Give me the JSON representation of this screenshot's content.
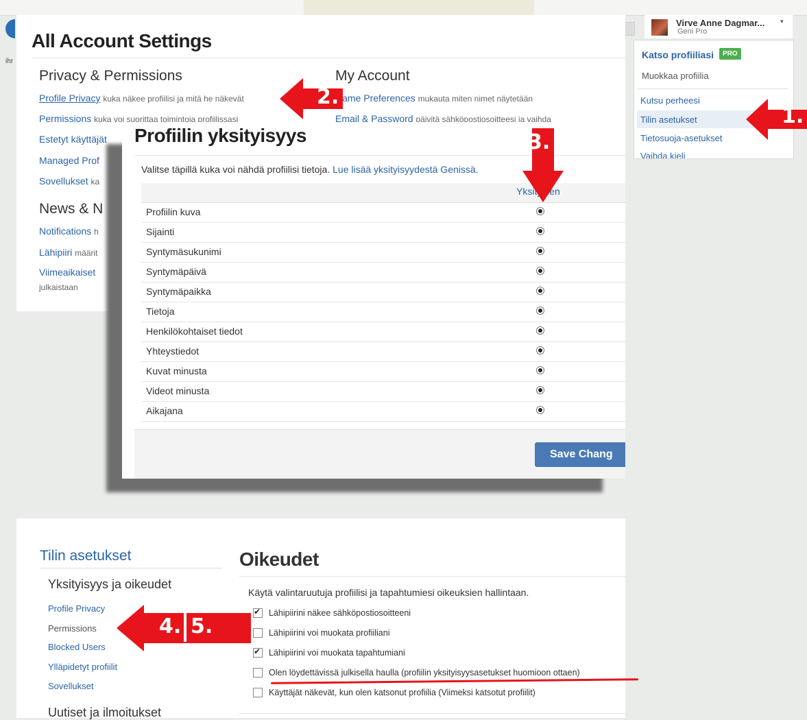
{
  "colors": {
    "link": "#2a64a8",
    "arrow": "#e8141b",
    "pro_badge": "#4caf50",
    "save_button": "#4a7ab5"
  },
  "account_settings": {
    "title": "All Account Settings",
    "privacy_heading": "Privacy & Permissions",
    "privacy_links": [
      {
        "label": "Profile Privacy",
        "desc": "kuka näkee profiilisi ja mitä he näkevät"
      },
      {
        "label": "Permissions",
        "desc": "kuka voi suorittaa toimintoja profiilissasi"
      },
      {
        "label": "Estetyt käyttäjät",
        "desc": ""
      },
      {
        "label": "Managed Prof",
        "desc": ""
      },
      {
        "label": "Sovellukset",
        "desc": "ka"
      }
    ],
    "news_heading": "News & N",
    "news_links": [
      {
        "label": "Notifications",
        "desc": "h"
      },
      {
        "label": "Lähipiiri",
        "desc": "määrit"
      },
      {
        "label": "Viimeaikaiset",
        "desc": ""
      }
    ],
    "news_extra": "julkaistaan",
    "my_account_heading": "My Account",
    "my_account_links": [
      {
        "label": "Name Preferences",
        "desc": "mukauta miten nimet näytetään"
      },
      {
        "label": "Email & Password",
        "desc": "päivitä sähköpostiosoitteesi ja vaihda"
      }
    ]
  },
  "user_menu": {
    "name": "Virve Anne Dagmar...",
    "plan": "Geni Pro",
    "view_profile": "Katso profiiliasi",
    "pro_badge": "PRO",
    "edit_profile": "Muokkaa profiilia",
    "items": [
      "Kutsu perheesi",
      "Tilin asetukset",
      "Tietosuoja-asetukset",
      "Vaihda kieli"
    ]
  },
  "profile_privacy": {
    "title": "Profiilin yksityisyys",
    "intro": "Valitse täpillä kuka voi nähdä profiilisi tietoja.",
    "intro_link": "Lue lisää yksityisyydestä Genissä.",
    "column_header": "Yksityinen",
    "rows": [
      "Profiilin kuva",
      "Sijainti",
      "Syntymäsukunimi",
      "Syntymäpäivä",
      "Syntymäpaikka",
      "Tietoja",
      "Henkilökohtaiset tiedot",
      "Yhteystiedot",
      "Kuvat minusta",
      "Videot minusta",
      "Aikajana"
    ],
    "save_button": "Save Chang"
  },
  "permissions_page": {
    "sidebar_title": "Tilin asetukset",
    "sidebar_section": "Yksityisyys ja oikeudet",
    "sidebar_links": [
      "Profile Privacy",
      "Permissions",
      "Blocked Users",
      "Ylläpidetyt profiilit",
      "Sovellukset"
    ],
    "sidebar_section2": "Uutiset ja ilmoitukset",
    "title": "Oikeudet",
    "intro": "Käytä valintaruutuja profiilisi ja tapahtumiesi oikeuksien hallintaan.",
    "options": [
      {
        "label": "Lähipiirini näkee sähköpostiosoitteeni",
        "checked": true
      },
      {
        "label": "Lähipiirini voi muokata profiiliani",
        "checked": false
      },
      {
        "label": "Lähipiirini voi muokata tapahtumiani",
        "checked": true
      },
      {
        "label": "Olen löydettävissä julkisella haulla (profiilin yksityisyysasetukset huomioon ottaen)",
        "checked": false
      },
      {
        "label": "Käyttäjät näkevät, kun olen katsonut profiilia (Viimeksi katsotut profiilit)",
        "checked": false
      }
    ]
  },
  "annotations": {
    "a1": "1.",
    "a2": "2.",
    "a3": "3.",
    "a4": "4.",
    "a5": "5."
  },
  "background": {
    "left_fragment": "ihr"
  }
}
